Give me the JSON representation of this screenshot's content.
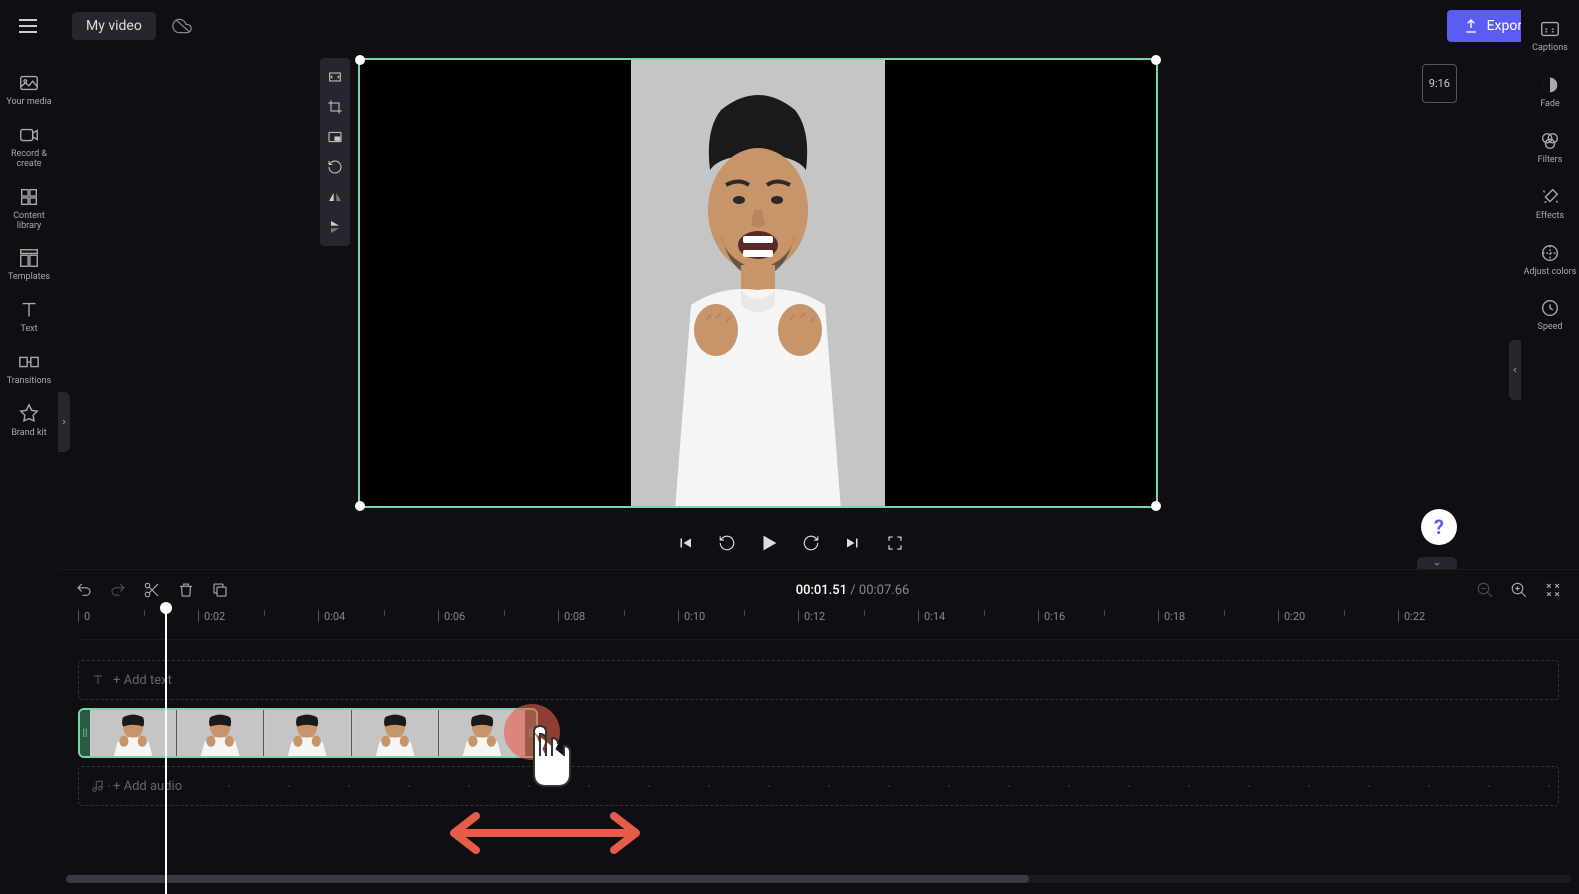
{
  "topbar": {
    "title": "My video",
    "export_label": "Export"
  },
  "left_sidebar": {
    "items": [
      {
        "label": "Your media",
        "icon": "media"
      },
      {
        "label": "Record & create",
        "icon": "record"
      },
      {
        "label": "Content library",
        "icon": "library"
      },
      {
        "label": "Templates",
        "icon": "templates"
      },
      {
        "label": "Text",
        "icon": "text"
      },
      {
        "label": "Transitions",
        "icon": "transitions"
      },
      {
        "label": "Brand kit",
        "icon": "brand"
      }
    ]
  },
  "right_sidebar": {
    "items": [
      {
        "label": "Captions",
        "icon": "cc"
      },
      {
        "label": "Fade",
        "icon": "fade"
      },
      {
        "label": "Filters",
        "icon": "filters"
      },
      {
        "label": "Effects",
        "icon": "effects"
      },
      {
        "label": "Adjust colors",
        "icon": "adjust"
      },
      {
        "label": "Speed",
        "icon": "speed"
      }
    ]
  },
  "canvas": {
    "aspect_label": "9:16"
  },
  "timeline": {
    "current_time": "00:01.51",
    "total_time": "00:07.66",
    "separator": " / ",
    "ruler_marks": [
      "0",
      "0:02",
      "0:04",
      "0:06",
      "0:08",
      "0:10",
      "0:12",
      "0:14",
      "0:16",
      "0:18",
      "0:20",
      "0:22"
    ],
    "add_text_label": "+ Add text",
    "add_audio_label": "+ Add audio"
  }
}
